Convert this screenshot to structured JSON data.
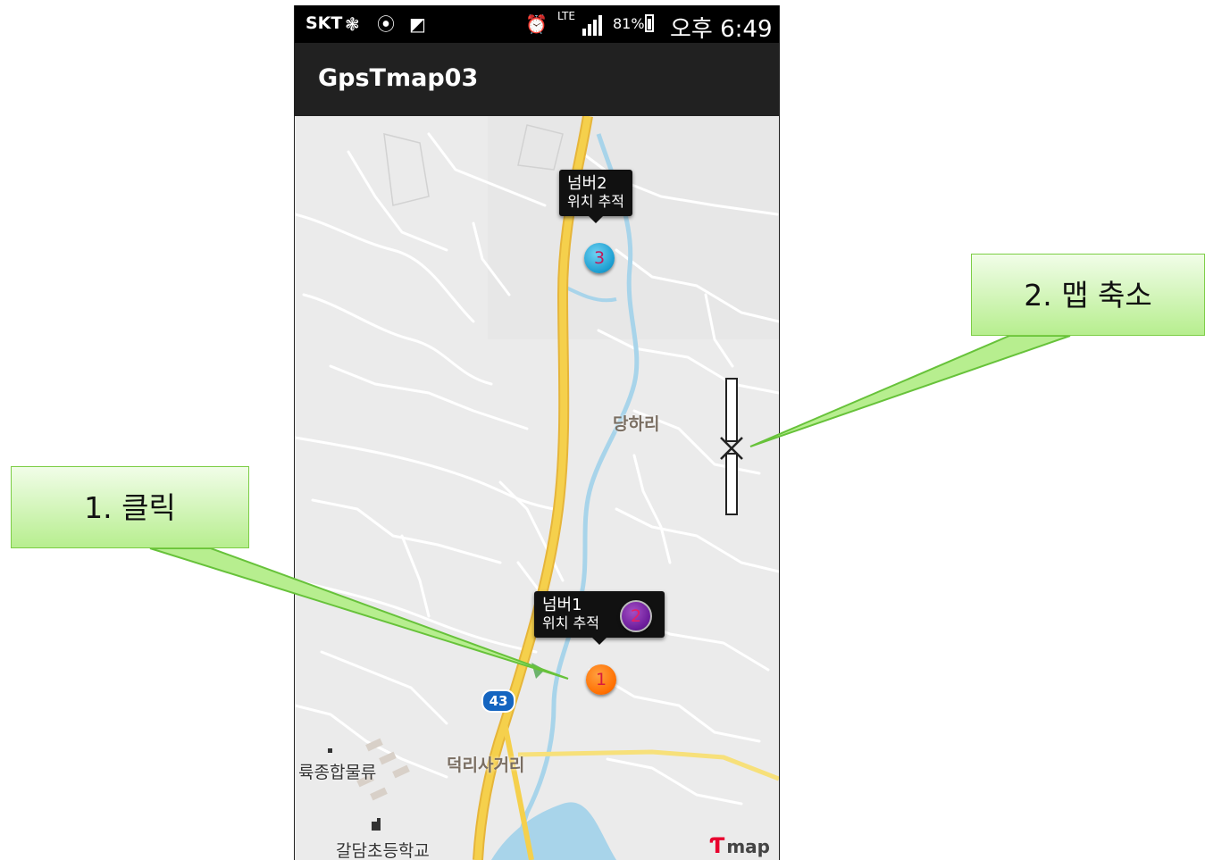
{
  "status_bar": {
    "carrier": "SKT",
    "lte": "LTE",
    "battery": "81%",
    "time": "오후 6:49",
    "icons": [
      "network-hub-icon",
      "chat-icon",
      "gallery-icon",
      "alarm-icon",
      "signal-icon",
      "battery-icon"
    ]
  },
  "app_bar": {
    "title": "GpsTmap03"
  },
  "map": {
    "places": {
      "danghari": "당하리",
      "deokrisa": "덕리사거리",
      "logistics": "륙종합물류",
      "school": "갈담초등학교"
    },
    "route_number": "43",
    "markers": [
      {
        "number": "1",
        "color": "#ff6f00"
      },
      {
        "number": "2",
        "color": "#6a1b9a"
      },
      {
        "number": "3",
        "color": "#1b9dd0"
      }
    ],
    "callouts": [
      {
        "title": "넘버2",
        "subtitle": "위치 추적"
      },
      {
        "title": "넘버1",
        "subtitle": "위치 추적"
      }
    ],
    "logo_text": "map"
  },
  "annotations": {
    "click": "1. 클릭",
    "zoom_out": "2. 맵 축소"
  },
  "colors": {
    "map_background": "#ebebeb",
    "highway": "#f5d04c",
    "river": "#a8d4ea",
    "label_box_top": "#f1fde8",
    "label_box_bottom": "#b7ee8f"
  }
}
